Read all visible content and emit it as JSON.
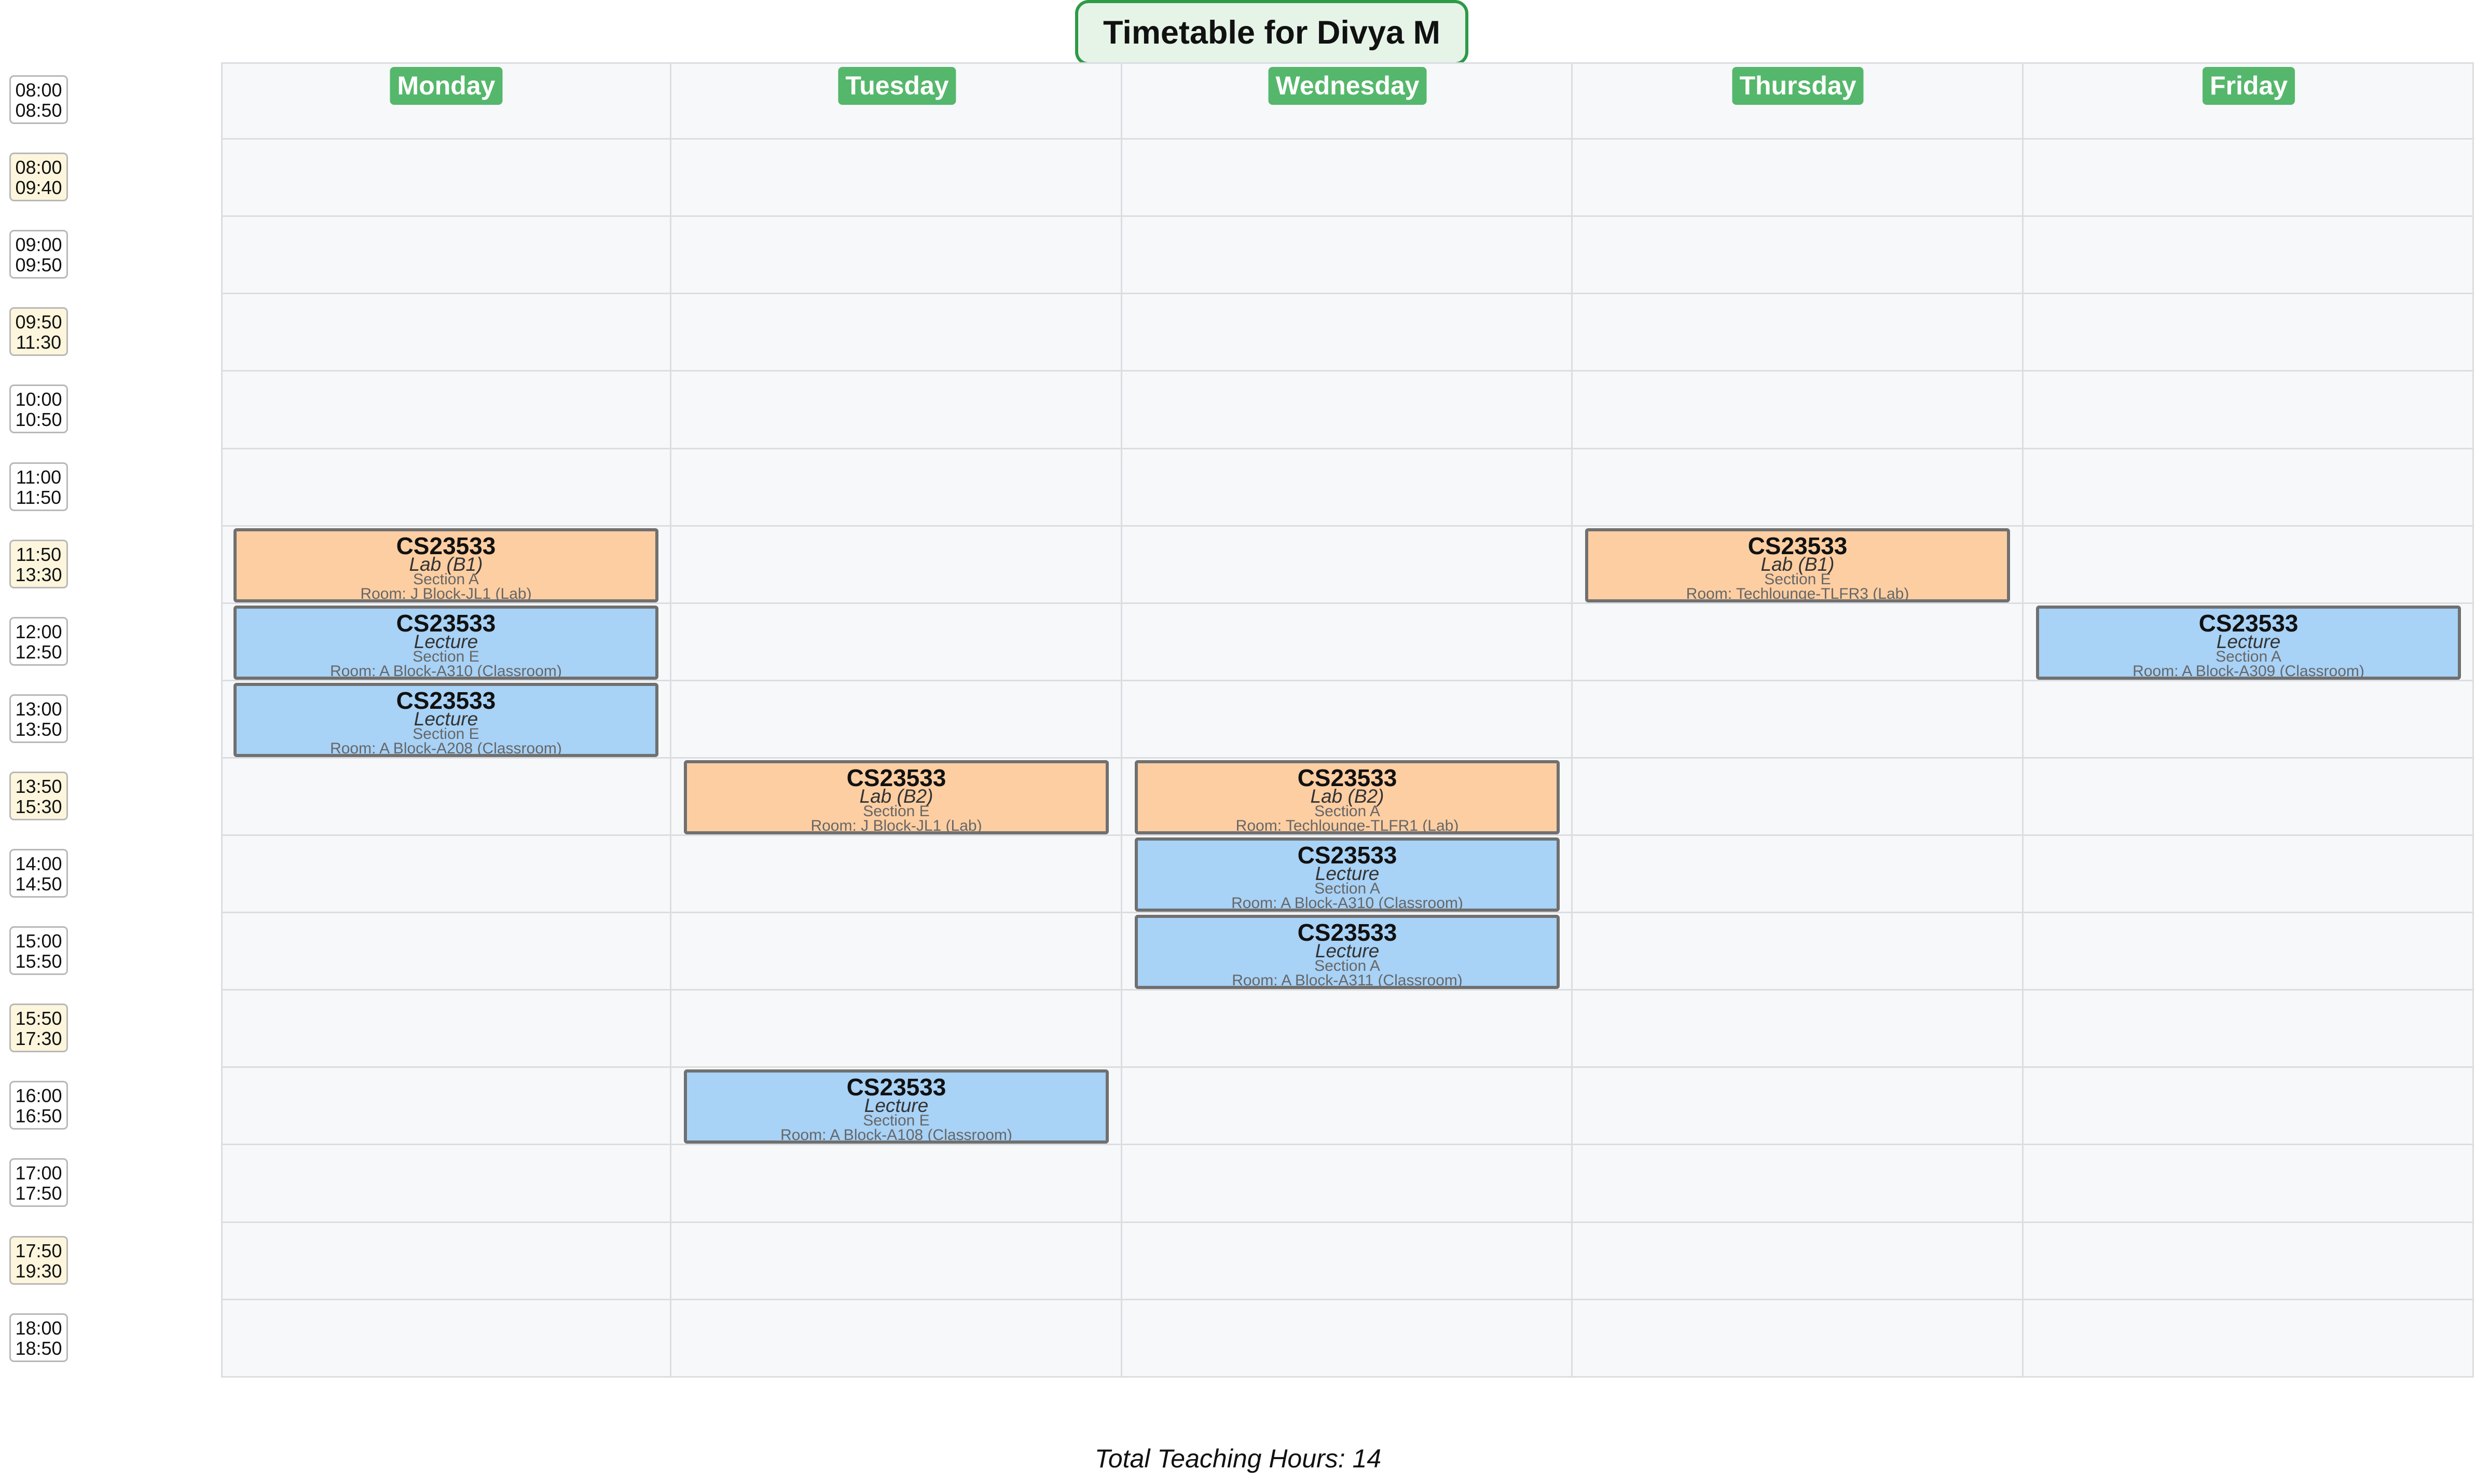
{
  "title": "Timetable for Divya M",
  "days": [
    "Monday",
    "Tuesday",
    "Wednesday",
    "Thursday",
    "Friday"
  ],
  "time_slots": [
    {
      "start": "08:00",
      "end": "08:50",
      "highlight": false
    },
    {
      "start": "08:00",
      "end": "09:40",
      "highlight": true
    },
    {
      "start": "09:00",
      "end": "09:50",
      "highlight": false
    },
    {
      "start": "09:50",
      "end": "11:30",
      "highlight": true
    },
    {
      "start": "10:00",
      "end": "10:50",
      "highlight": false
    },
    {
      "start": "11:00",
      "end": "11:50",
      "highlight": false
    },
    {
      "start": "11:50",
      "end": "13:30",
      "highlight": true
    },
    {
      "start": "12:00",
      "end": "12:50",
      "highlight": false
    },
    {
      "start": "13:00",
      "end": "13:50",
      "highlight": false
    },
    {
      "start": "13:50",
      "end": "15:30",
      "highlight": true
    },
    {
      "start": "14:00",
      "end": "14:50",
      "highlight": false
    },
    {
      "start": "15:00",
      "end": "15:50",
      "highlight": false
    },
    {
      "start": "15:50",
      "end": "17:30",
      "highlight": true
    },
    {
      "start": "16:00",
      "end": "16:50",
      "highlight": false
    },
    {
      "start": "17:00",
      "end": "17:50",
      "highlight": false
    },
    {
      "start": "17:50",
      "end": "19:30",
      "highlight": true
    },
    {
      "start": "18:00",
      "end": "18:50",
      "highlight": false
    }
  ],
  "sessions": [
    {
      "day": "Monday",
      "slot": "11:50-13:30",
      "type": "lab",
      "code": "CS23533",
      "kind": "Lab (B1)",
      "section": "Section A",
      "room": "Room: J Block-JL1 (Lab)"
    },
    {
      "day": "Monday",
      "slot": "12:00-12:50",
      "type": "lecture",
      "code": "CS23533",
      "kind": "Lecture",
      "section": "Section E",
      "room": "Room: A Block-A310 (Classroom)"
    },
    {
      "day": "Monday",
      "slot": "13:00-13:50",
      "type": "lecture",
      "code": "CS23533",
      "kind": "Lecture",
      "section": "Section E",
      "room": "Room: A Block-A208 (Classroom)"
    },
    {
      "day": "Tuesday",
      "slot": "13:50-15:30",
      "type": "lab",
      "code": "CS23533",
      "kind": "Lab (B2)",
      "section": "Section E",
      "room": "Room: J Block-JL1 (Lab)"
    },
    {
      "day": "Tuesday",
      "slot": "16:00-16:50",
      "type": "lecture",
      "code": "CS23533",
      "kind": "Lecture",
      "section": "Section E",
      "room": "Room: A Block-A108 (Classroom)"
    },
    {
      "day": "Wednesday",
      "slot": "13:50-15:30",
      "type": "lab",
      "code": "CS23533",
      "kind": "Lab (B2)",
      "section": "Section A",
      "room": "Room: Techlounge-TLFR1 (Lab)"
    },
    {
      "day": "Wednesday",
      "slot": "14:00-14:50",
      "type": "lecture",
      "code": "CS23533",
      "kind": "Lecture",
      "section": "Section A",
      "room": "Room: A Block-A310 (Classroom)"
    },
    {
      "day": "Wednesday",
      "slot": "15:00-15:50",
      "type": "lecture",
      "code": "CS23533",
      "kind": "Lecture",
      "section": "Section A",
      "room": "Room: A Block-A311 (Classroom)"
    },
    {
      "day": "Thursday",
      "slot": "11:50-13:30",
      "type": "lab",
      "code": "CS23533",
      "kind": "Lab (B1)",
      "section": "Section E",
      "room": "Room: Techlounge-TLFR3 (Lab)"
    },
    {
      "day": "Friday",
      "slot": "12:00-12:50",
      "type": "lecture",
      "code": "CS23533",
      "kind": "Lecture",
      "section": "Section A",
      "room": "Room: A Block-A309 (Classroom)"
    }
  ],
  "footer": "Total Teaching Hours: 14",
  "colors": {
    "lab": "#fdcea2",
    "lecture": "#a8d2f6",
    "day_header": "#55b76b",
    "title_border": "#2e9a46",
    "highlight_slot": "#fdf6dc"
  }
}
